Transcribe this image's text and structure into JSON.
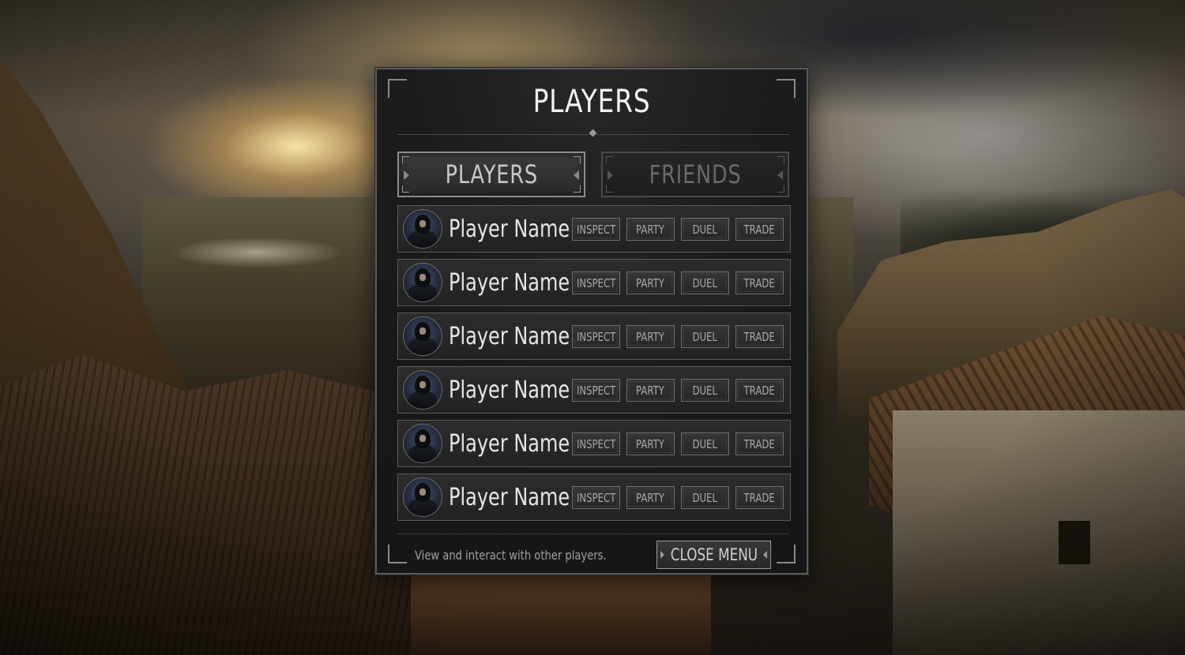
{
  "panel": {
    "title": "PLAYERS"
  },
  "tabs": [
    {
      "label": "PLAYERS",
      "active": true
    },
    {
      "label": "FRIENDS",
      "active": false
    }
  ],
  "actions": {
    "inspect": "INSPECT",
    "party": "PARTY",
    "duel": "DUEL",
    "trade": "TRADE"
  },
  "players": [
    {
      "name": "Player Name"
    },
    {
      "name": "Player Name"
    },
    {
      "name": "Player Name"
    },
    {
      "name": "Player Name"
    },
    {
      "name": "Player Name"
    },
    {
      "name": "Player Name"
    }
  ],
  "footer": {
    "hint": "View and interact with other players.",
    "close_label": "CLOSE MENU"
  },
  "colors": {
    "panel_bg": "#1a1a1a",
    "panel_border": "#5a5a5a",
    "text_primary": "#e6e6e6",
    "text_muted": "#a0a0a0"
  }
}
